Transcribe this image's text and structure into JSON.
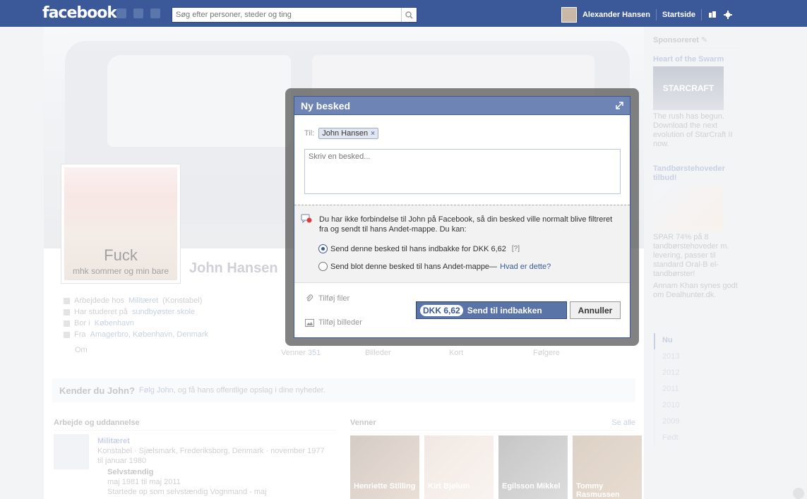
{
  "topbar": {
    "logo": "facebook",
    "search_placeholder": "Søg efter personer, steder og ting",
    "user_name": "Alexander Hansen",
    "home_label": "Startside"
  },
  "profile": {
    "name": "John Hansen",
    "picture_caption_1": "Fuck",
    "picture_caption_2": "mhk sommer og min bare",
    "info": [
      {
        "prefix": "Arbejdede hos ",
        "link": "Militæret",
        "suffix": " (Konstabel)"
      },
      {
        "prefix": "Har studeret på ",
        "link": "sundbyøster skole",
        "suffix": ""
      },
      {
        "prefix": "Bor i ",
        "link": "København",
        "suffix": ""
      },
      {
        "prefix": "Fra ",
        "link": "Amagerbro, København, Denmark",
        "suffix": ""
      }
    ],
    "about_label": "Om",
    "tabs": {
      "friends": "Venner",
      "friends_count": "351",
      "photos": "Billeder",
      "map": "Kort",
      "followers": "Følgere"
    }
  },
  "kender": {
    "title": "Kender du John?",
    "link": "Følg John",
    "text": ", og få hans offentlige opslag i dine nyheder."
  },
  "work": {
    "header": "Arbejde og uddannelse",
    "employer": "Militæret",
    "detail": "Konstabel · Sjælsmark, Frederiksborg, Denmark · november 1977 til januar 1980",
    "sub_title": "Selvstændig",
    "sub_period": "maj 1981 til maj 2011",
    "sub_desc": "Startede op som selvstændig Vognmand - maj"
  },
  "friends": {
    "header": "Venner",
    "see_all": "Se alle",
    "items": [
      {
        "name": "Henriette Stilling"
      },
      {
        "name": "Kirt Bjølum"
      },
      {
        "name": "Egilsson Mikkel"
      },
      {
        "name": "Tommy Rasmussen"
      }
    ]
  },
  "sponsored": {
    "header": "Sponsoreret",
    "ads": [
      {
        "title": "Heart of the Swarm",
        "logo_text": "STARCRAFT",
        "text": "The rush has begun. Download the next evolution of StarCraft II now.",
        "social": ""
      },
      {
        "title": "Tandbørstehoveder tilbud!",
        "logo_text": "",
        "text": "SPAR 74% på 8 tandbørstehoveder m. levering, passer til standard Oral-B el-tandbørster!",
        "social": "Annam Khan synes godt om Dealhunter.dk."
      }
    ]
  },
  "timeline": [
    "Nu",
    "2013",
    "2012",
    "2011",
    "2010",
    "2009",
    "Født"
  ],
  "dialog": {
    "title": "Ny besked",
    "to_label": "Til:",
    "recipient": "John Hansen",
    "message_placeholder": "Skriv en besked...",
    "notice": "Du har ikke forbindelse til John på Facebook, så din besked ville normalt blive filtreret fra og sendt til hans Andet-mappe. Du kan:",
    "option1": "Send denne besked til hans indbakke for DKK 6,62",
    "option1_help": "[?]",
    "option2": "Send blot denne besked til hans Andet-mappe—",
    "option2_link": "Hvad er dette?",
    "attach_files": "Tilføj filer",
    "attach_photos": "Tilføj billeder",
    "send_price": "DKK 6,62",
    "send_label": "Send til indbakken",
    "cancel_label": "Annuller"
  }
}
